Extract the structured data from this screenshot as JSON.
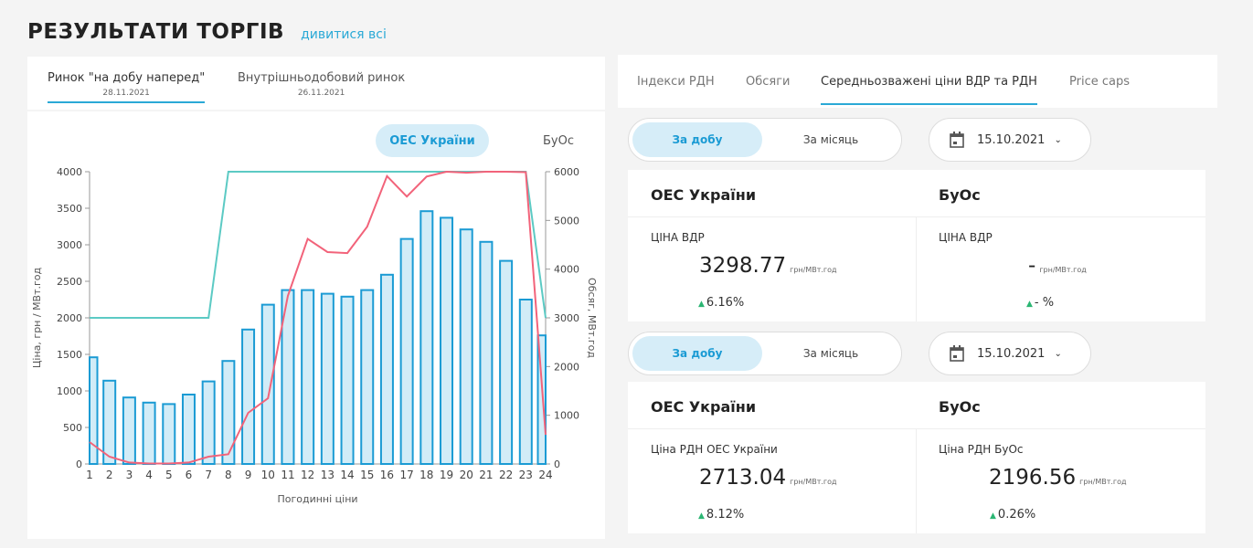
{
  "header": {
    "title": "РЕЗУЛЬТАТИ ТОРГІВ",
    "link": "дивитися всі"
  },
  "market_tabs": [
    {
      "label": "Ринок \"на добу наперед\"",
      "date": "28.11.2021"
    },
    {
      "label": "Внутрішньодобовий ринок",
      "date": "26.11.2021"
    }
  ],
  "chart_toggle": {
    "active": "ОЕС України",
    "inactive": "БуОс"
  },
  "chart_data": {
    "type": "bar",
    "title": "",
    "xlabel": "Погодинні ціни",
    "ylabel": "Ціна, грн / МВт.год",
    "y2label": "Обсяг, МВт.год",
    "categories": [
      "1",
      "2",
      "3",
      "4",
      "5",
      "6",
      "7",
      "8",
      "9",
      "10",
      "11",
      "12",
      "13",
      "14",
      "15",
      "16",
      "17",
      "18",
      "19",
      "20",
      "21",
      "22",
      "23",
      "24"
    ],
    "ylim": [
      0,
      4000
    ],
    "y2lim": [
      0,
      6000
    ],
    "yticks": [
      0,
      500,
      1000,
      1500,
      2000,
      2500,
      3000,
      3500,
      4000
    ],
    "y2ticks": [
      0,
      1000,
      2000,
      3000,
      4000,
      5000,
      6000
    ],
    "bars": [
      1460,
      1140,
      910,
      840,
      820,
      950,
      1130,
      1410,
      1840,
      2180,
      2380,
      2380,
      2330,
      2290,
      2380,
      2590,
      3080,
      3460,
      3370,
      3210,
      3040,
      2780,
      2250,
      1760
    ],
    "price_cap_line": [
      2000,
      2000,
      2000,
      2000,
      2000,
      2000,
      2000,
      4000,
      4000,
      4000,
      4000,
      4000,
      4000,
      4000,
      4000,
      4000,
      4000,
      4000,
      4000,
      4000,
      4000,
      4000,
      4000,
      2000
    ],
    "volume_line": [
      450,
      150,
      30,
      10,
      10,
      30,
      150,
      200,
      1050,
      1350,
      3450,
      4620,
      4350,
      4330,
      4870,
      5910,
      5490,
      5900,
      6000,
      5980,
      6000,
      6000,
      5990,
      600
    ],
    "colors": {
      "bar_fill": "#d2ecf7",
      "bar_stroke": "#1b9bd4",
      "cap_line": "#5ccac4",
      "volume_line": "#f2637a"
    }
  },
  "right_tabs": [
    "Індекси РДН",
    "Обсяги",
    "Середньозважені ціни ВДР та РДН",
    "Price caps"
  ],
  "block1": {
    "toggle_on": "За добу",
    "toggle_off": "За місяць",
    "date": "15.10.2021",
    "col1_title": "ОЕС України",
    "col2_title": "БуОс",
    "col1_label": "ЦІНА ВДР",
    "col2_label": "ЦІНА ВДР",
    "col1_value": "3298.77",
    "col2_value": "-",
    "unit": "грн/МВт.год",
    "col1_delta": "6.16%",
    "col2_delta": "- %"
  },
  "block2": {
    "toggle_on": "За добу",
    "toggle_off": "За місяць",
    "date": "15.10.2021",
    "col1_title": "ОЕС України",
    "col2_title": "БуОс",
    "col1_label": "Ціна РДН ОЕС України",
    "col2_label": "Ціна РДН БуОс",
    "col1_value": "2713.04",
    "col2_value": "2196.56",
    "unit": "грн/МВт.год",
    "col1_delta": "8.12%",
    "col2_delta": "0.26%"
  },
  "icons": {
    "calendar": "calendar-icon",
    "chevron": "chevron-down-icon",
    "delta": "triangle-up-icon"
  }
}
